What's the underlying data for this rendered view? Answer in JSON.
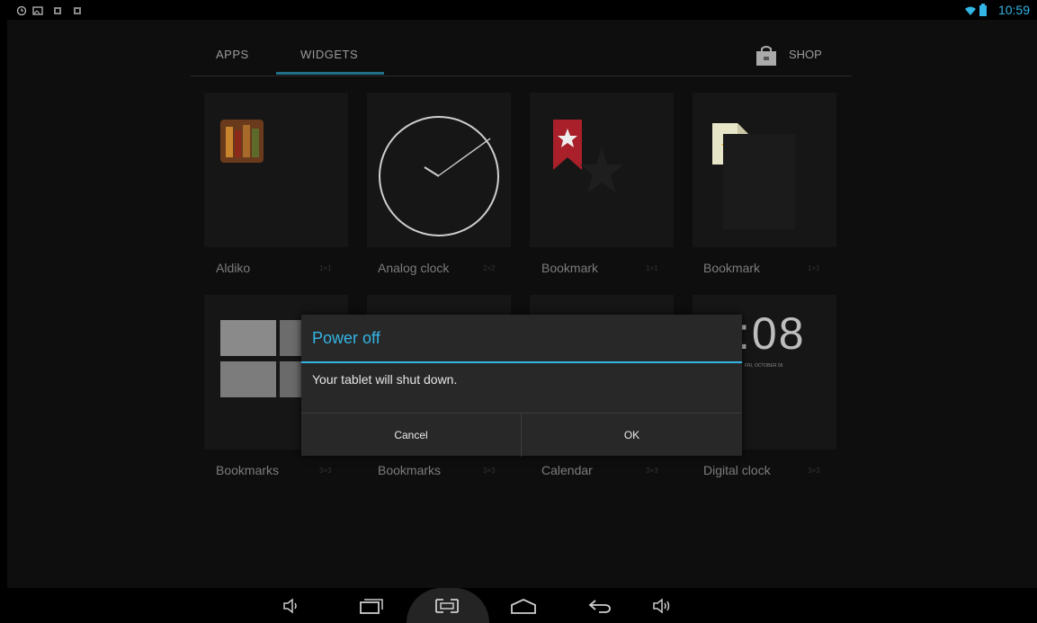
{
  "status_bar": {
    "time": "10:59",
    "left_icons": [
      "alarm-icon",
      "screenshot-icon",
      "notification-icon",
      "notification-icon"
    ],
    "right_icons": [
      "wifi-icon",
      "battery-icon"
    ]
  },
  "tabs": {
    "apps": "APPS",
    "widgets": "WIDGETS",
    "shop": "SHOP",
    "active": "WIDGETS"
  },
  "widgets": [
    {
      "name": "Aldiko",
      "size": "1×1"
    },
    {
      "name": "Analog clock",
      "size": "2×2"
    },
    {
      "name": "Bookmark",
      "size": "1×1"
    },
    {
      "name": "Bookmark",
      "size": "1×1"
    },
    {
      "name": "Bookmarks",
      "size": "3×3"
    },
    {
      "name": "Bookmarks",
      "size": "3×3"
    },
    {
      "name": "Calendar",
      "size": "3×3"
    },
    {
      "name": "Digital clock",
      "size": "3×3"
    }
  ],
  "digital_clock_preview": {
    "time": ":08",
    "date": "FRI, OCTOBER 05"
  },
  "dialog": {
    "title": "Power off",
    "message": "Your tablet will shut down.",
    "cancel": "Cancel",
    "ok": "OK"
  },
  "nav_bar": {
    "buttons": [
      "volume-down-icon",
      "recent-apps-icon",
      "screenshot-icon",
      "home-icon",
      "back-icon",
      "volume-up-icon"
    ]
  },
  "colors": {
    "accent": "#33b5e5",
    "background": "#000000",
    "dialog": "#282828"
  }
}
